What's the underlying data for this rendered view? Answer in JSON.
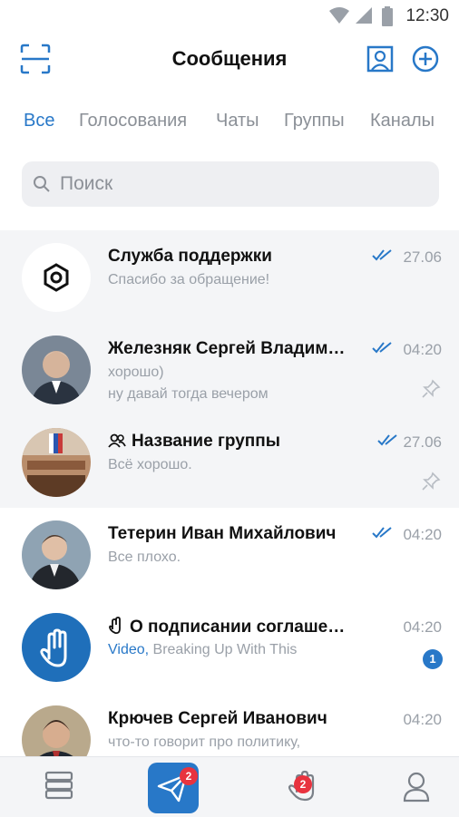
{
  "status_bar": {
    "time": "12:30"
  },
  "header": {
    "title": "Сообщения"
  },
  "tabs": [
    {
      "label": "Все",
      "active": true
    },
    {
      "label": "Голосования",
      "active": false
    },
    {
      "label": "Чаты",
      "active": false
    },
    {
      "label": "Группы",
      "active": false
    },
    {
      "label": "Каналы",
      "active": false
    }
  ],
  "search": {
    "placeholder": "Поиск"
  },
  "chats": [
    {
      "name": "Служба поддержки",
      "line1": "Спасибо за обращение!",
      "time": "27.06",
      "read": true,
      "pinned": true,
      "avatar": "support-logo"
    },
    {
      "name": "Железняк Сергей Владимирович",
      "line1": "хорошо)",
      "line2": "ну давай тогда вечером",
      "time": "04:20",
      "read": true,
      "pinned": true,
      "avatar": "person-photo"
    },
    {
      "name": "Название группы",
      "line1": "Всё хорошо.",
      "time": "27.06",
      "read": true,
      "pinned": true,
      "avatar": "group-photo",
      "icon": "group-icon"
    },
    {
      "name": "Тетерин Иван Михайлович",
      "line1": "Все плохо.",
      "time": "04:20",
      "read": true,
      "pinned": false,
      "avatar": "person-photo"
    },
    {
      "name": "О подписании соглашения",
      "line1_accent": "Video,",
      "line1": "Breaking Up With This",
      "time": "04:20",
      "unread": "1",
      "avatar": "vote-hand",
      "icon": "vote-icon"
    },
    {
      "name": "Крючев Сергей Иванович",
      "line1": "что-то говорит про политику,",
      "time": "04:20",
      "avatar": "person-photo"
    }
  ],
  "bottom_nav": {
    "messages_badge": "2",
    "votes_badge": "2"
  },
  "colors": {
    "accent": "#2878c8",
    "badge_red": "#e8333f",
    "muted": "#9aa0a8"
  }
}
